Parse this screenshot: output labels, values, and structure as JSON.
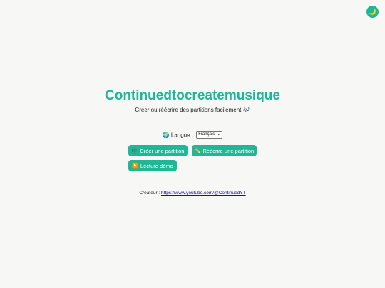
{
  "theme_toggle": {
    "icon": "moon-icon",
    "glyph": "🌙"
  },
  "header": {
    "title": "Continuedtocreatemusique",
    "subtitle": "Créer ou réécrire des partitions facilement 🎶"
  },
  "language": {
    "icon": "globe-icon",
    "glyph": "🌍",
    "label": "Langue :",
    "selected": "Français"
  },
  "actions": {
    "create": {
      "glyph": "🎼",
      "label": "Créer une partition",
      "icon": "score-icon"
    },
    "rewrite": {
      "glyph": "✏️",
      "label": "Réécrire une partition",
      "icon": "pencil-icon"
    },
    "demo": {
      "glyph": "▶️",
      "label": "Lecture démo",
      "icon": "play-icon"
    }
  },
  "footer": {
    "creator_label": "Créateur :",
    "creator_link": "https://www.youtube.com/@ContinuedYT"
  },
  "colors": {
    "accent": "#1fb897",
    "background": "#f7f7f6",
    "link": "#1a0dab"
  }
}
